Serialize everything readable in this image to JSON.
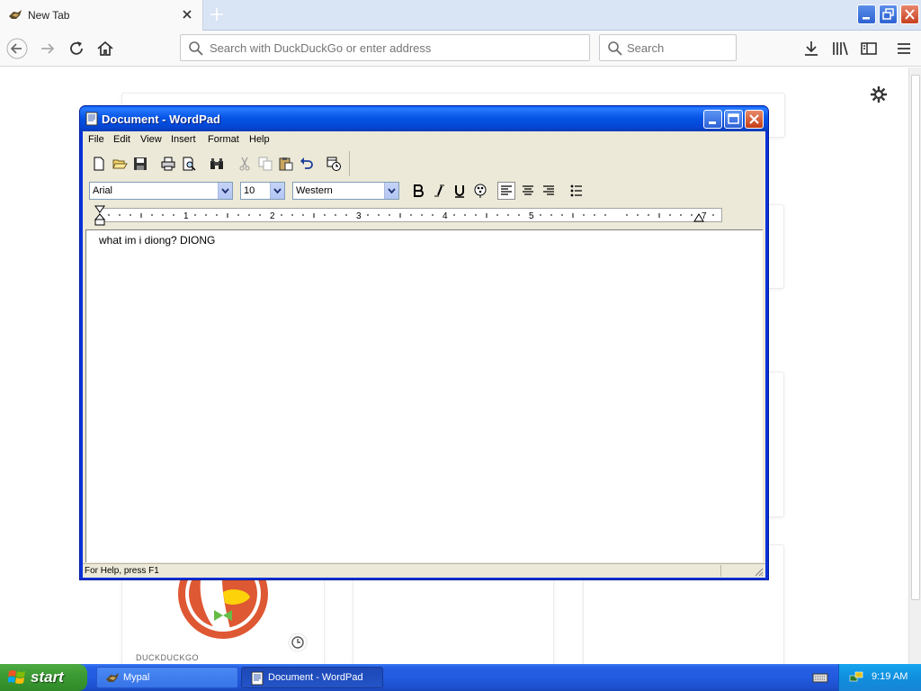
{
  "browser": {
    "tab_title": "New Tab",
    "url_placeholder": "Search with DuckDuckGo or enter address",
    "search_placeholder": "Search"
  },
  "newtab_page": {
    "ddg_label": "DUCKDUCKGO"
  },
  "wordpad": {
    "title": "Document - WordPad",
    "menu": [
      "File",
      "Edit",
      "View",
      "Insert",
      "Format",
      "Help"
    ],
    "font": "Arial",
    "font_size": "10",
    "script": "Western",
    "ruler_numbers": [
      "1",
      "2",
      "3",
      "4",
      "5",
      "7"
    ],
    "document_text": "what im i diong? DIONG",
    "status": "For Help, press F1"
  },
  "taskbar": {
    "start_label": "start",
    "items": [
      "Mypal",
      "Document - WordPad"
    ],
    "time": "9:19 AM"
  },
  "colors": {
    "xp_title_blue": "#0a5ef5",
    "taskbar_blue": "#225bdf",
    "start_green": "#3d9b34",
    "tray_blue": "#0f8fde",
    "ddg_orange": "#de5833"
  }
}
